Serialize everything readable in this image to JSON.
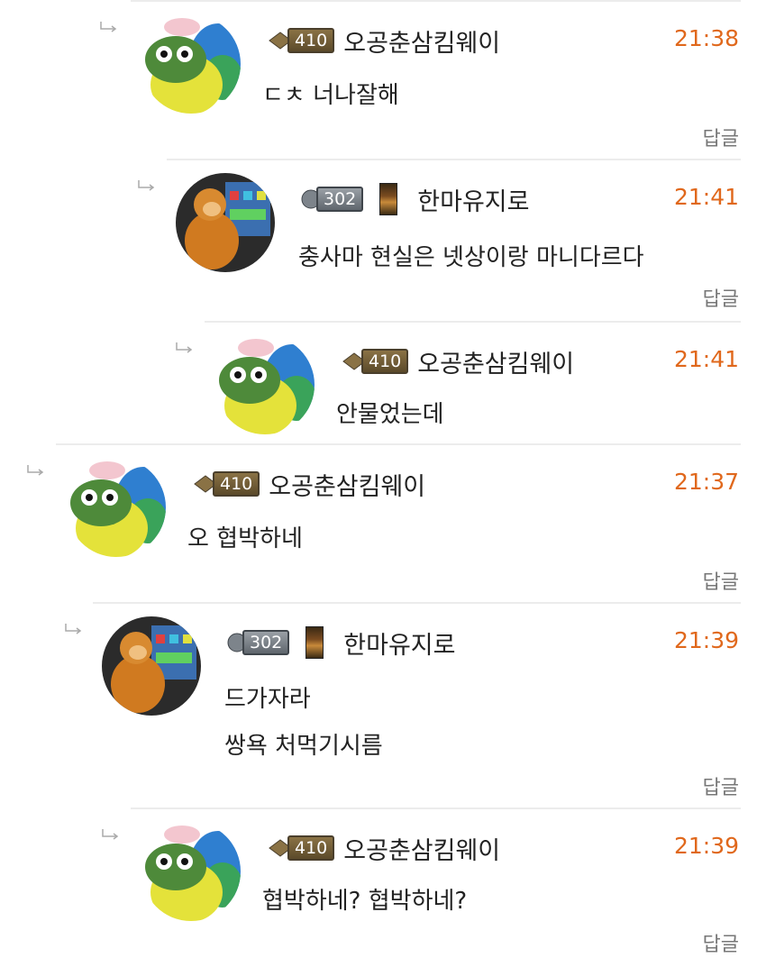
{
  "comments": [
    {
      "level": "410",
      "badge": "gold",
      "name": "오공춘삼킴웨이",
      "time": "21:38",
      "lines": [
        "ㄷㅊ 너나잘해"
      ],
      "reply": "답글"
    },
    {
      "level": "302",
      "badge": "silver",
      "name": "한마유지로",
      "time": "21:41",
      "lines": [
        "충사마 현실은 넷상이랑 마니다르다"
      ],
      "reply": "답글"
    },
    {
      "level": "410",
      "badge": "gold",
      "name": "오공춘삼킴웨이",
      "time": "21:41",
      "lines": [
        "안물었는데"
      ],
      "reply": ""
    },
    {
      "level": "410",
      "badge": "gold",
      "name": "오공춘삼킴웨이",
      "time": "21:37",
      "lines": [
        "오 협박하네"
      ],
      "reply": "답글"
    },
    {
      "level": "302",
      "badge": "silver",
      "name": "한마유지로",
      "time": "21:39",
      "lines": [
        "드가자라",
        "쌍욕 처먹기시름"
      ],
      "reply": "답글"
    },
    {
      "level": "410",
      "badge": "gold",
      "name": "오공춘삼킴웨이",
      "time": "21:39",
      "lines": [
        "협박하네? 협박하네?"
      ],
      "reply": "답글"
    }
  ],
  "icons": {
    "reply_arrow": "reply-arrow-icon",
    "avatar_pepe": "pepe-avatar",
    "avatar_monkey": "monkey-avatar",
    "level_badge": "level-badge-icon",
    "card_icon": "card-icon"
  },
  "colors": {
    "time": "#e0681c",
    "divider": "#ececec",
    "text": "#222222",
    "reply": "#777777"
  }
}
